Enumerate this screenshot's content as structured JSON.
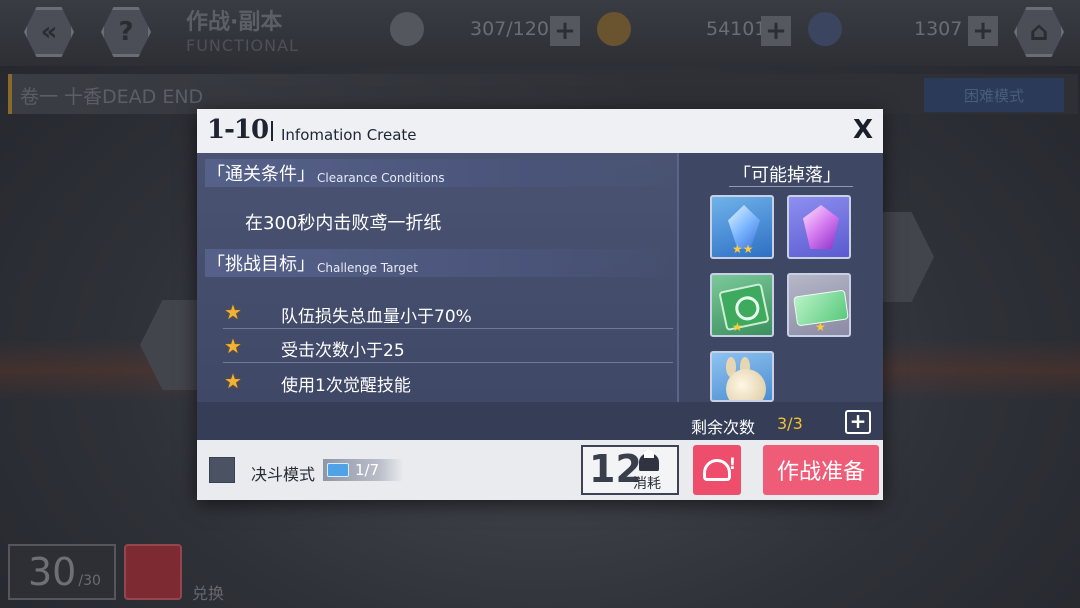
{
  "background": {
    "title_cn": "作战·副本",
    "title_en": "FUNCTIONAL",
    "stamina": "307/120",
    "gold": "54101",
    "crystal": "1307",
    "chapter": "卷一  十香DEAD END",
    "hard_mode": "困难模式",
    "stars_count": "30",
    "stars_total": "/30",
    "exchange": "兑换"
  },
  "dialog": {
    "stage_id": "1-10",
    "stage_subtitle": "Infomation Create",
    "close_label": "X",
    "clearance": {
      "title_cn": "「通关条件」",
      "title_en": "Clearance Conditions",
      "text": "在300秒内击败鸢一折纸"
    },
    "challenge": {
      "title_cn": "「挑战目标」",
      "title_en": "Challenge Target",
      "targets": [
        "队伍损失总血量小于70%",
        "受击次数小于25",
        "使用1次觉醒技能"
      ]
    },
    "drops": {
      "title": "「可能掉落」",
      "items": [
        "blue-crystal-icon",
        "purple-crystal-icon",
        "green-ticket-icon",
        "gold-card-icon",
        "pet-icon"
      ]
    },
    "remaining": {
      "label": "剩余次数",
      "value": "3/3"
    },
    "footer": {
      "duel_label": "决斗模式",
      "duel_count": "1/7",
      "cost_value": "12",
      "cost_label": "消耗",
      "battle_button": "作战准备"
    }
  },
  "colors": {
    "accent_pink": "#ee5c77",
    "panel_blue": "#3e4763",
    "star_gold": "#f2b233"
  }
}
